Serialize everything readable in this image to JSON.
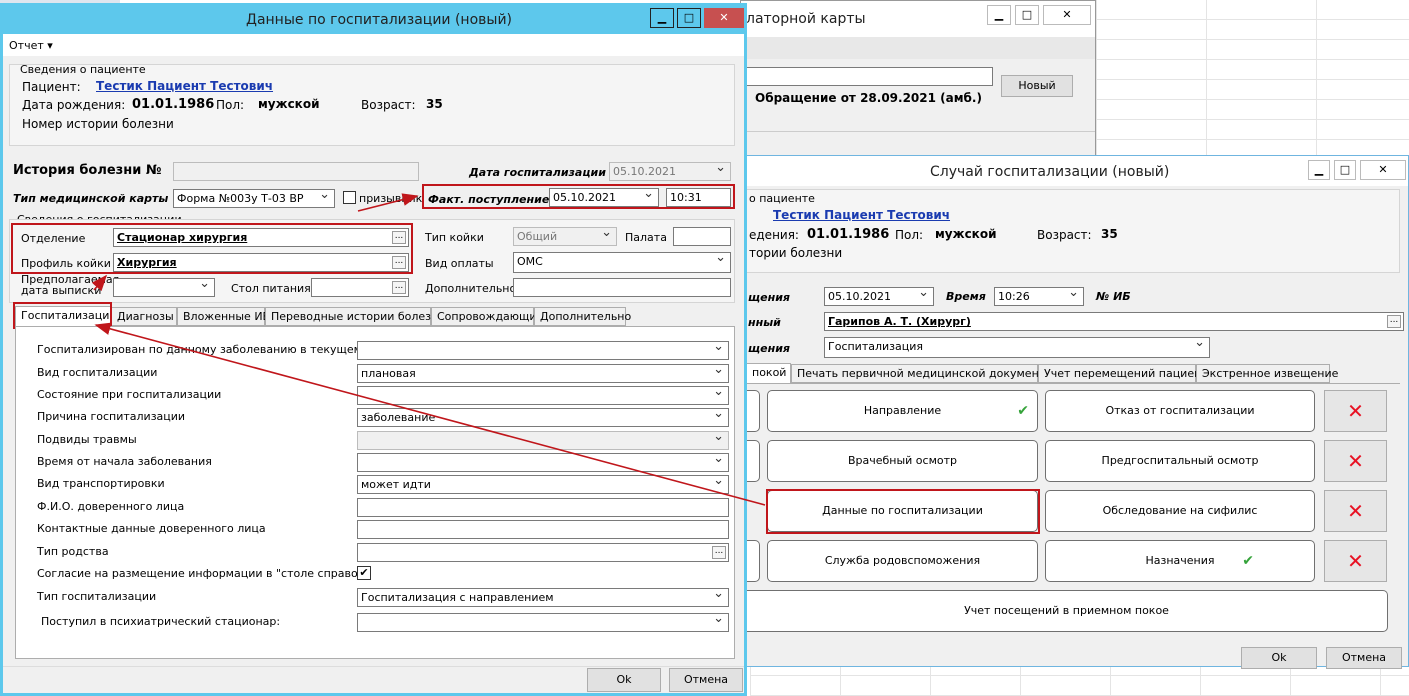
{
  "bg": {
    "left_window_title": "латорной карты",
    "top_input": "",
    "new_button": "Новый",
    "obr": "Обращение от 28.09.2021 (амб.)"
  },
  "hosp": {
    "title": "Данные по госпитализации (новый)",
    "menu": "Отчет ▾",
    "patient_group": "Сведения о пациенте",
    "patient_label": "Пациент:",
    "patient": "Тестик Пациент Тестович",
    "dob_label": "Дата рождения:",
    "dob": "01.01.1986",
    "sex_label": "Пол:",
    "sex": "мужской",
    "age_label": "Возраст:",
    "age": "35",
    "history_label": "Номер истории болезни",
    "ib_label": "История болезни №",
    "ib": "",
    "date_label": "Дата госпитализации",
    "date": "05.10.2021",
    "type_label": "Тип медицинской карты",
    "type": "Форма №003у Т-03 ВР",
    "conscript": "призывник",
    "fact_label": "Факт. поступление",
    "fact_date": "05.10.2021",
    "fact_time": "10:31",
    "info_group": "Сведения о госпитализации",
    "dept_label": "Отделение",
    "dept": "Стационар  хирургия",
    "bed_label": "Профиль койки",
    "bed": "Хирургия",
    "bedtype_label": "Тип койки",
    "bedtype": "Общий",
    "ward_label": "Палата",
    "ward": "",
    "pay_label": "Вид оплаты",
    "pay": "ОМС",
    "disch_label": "Предполагаемая дата выписки",
    "disch": "",
    "table_label": "Стол питания",
    "table": "",
    "extra_label": "Дополнительно",
    "extra": "",
    "tabs": [
      "Госпитализация",
      "Диагнозы",
      "Вложенные ИБ",
      "Переводные истории болезни",
      "Сопровождающие",
      "Дополнительно"
    ],
    "fields": [
      {
        "label": "Госпитализирован по данному заболеванию в текущем году",
        "value": ""
      },
      {
        "label": "Вид госпитализации",
        "value": "плановая"
      },
      {
        "label": "Состояние при госпитализации",
        "value": ""
      },
      {
        "label": "Причина госпитализации",
        "value": "заболевание"
      },
      {
        "label": "Подвиды травмы",
        "value": ""
      },
      {
        "label": "Время от начала заболевания",
        "value": ""
      },
      {
        "label": "Вид транспортировки",
        "value": "может идти"
      },
      {
        "label": "Ф.И.О. доверенного лица",
        "value": ""
      },
      {
        "label": "Контактные данные доверенного лица",
        "value": ""
      },
      {
        "label": "Тип родства",
        "value": ""
      },
      {
        "label": "Согласие на размещение информации в \"столе справок\"",
        "value": "✔"
      },
      {
        "label": "Тип госпитализации",
        "value": "Госпитализация с направлением"
      },
      {
        "label": "Поступил в психиатрический стационар:",
        "value": ""
      }
    ],
    "ok": "Ok",
    "cancel": "Отмена"
  },
  "sluch": {
    "title": "Случай госпитализации (новый)",
    "patient_group": "о пациенте",
    "patient": "Тестик Пациент Тестович",
    "dob_label": "едения:",
    "dob": "01.01.1986",
    "sex_label": "Пол:",
    "sex": "мужской",
    "age_label": "Возраст:",
    "age": "35",
    "history_label": "тории болезни",
    "date_label": "щения",
    "date": "05.10.2021",
    "time_label": "Время",
    "time": "10:26",
    "ib_label": "№ ИБ",
    "doc_label": "нный",
    "doc": "Гарипов А. Т. (Хирург)",
    "kind_label": "щения",
    "kind": "Госпитализация",
    "tabs": [
      "покой",
      "Печать первичной медицинской документации",
      "Учет перемещений пациента",
      "Экстренное извещение"
    ],
    "tiles": [
      "Направление",
      "Отказ от госпитализации",
      "Врачебный осмотр",
      "Предгоспитальный осмотр",
      "Данные по госпитализации",
      "Обследование на сифилис",
      "Служба родовспоможения",
      "Назначения",
      "Учет посещений в приемном покое"
    ],
    "ok": "Ok",
    "cancel": "Отмена"
  }
}
